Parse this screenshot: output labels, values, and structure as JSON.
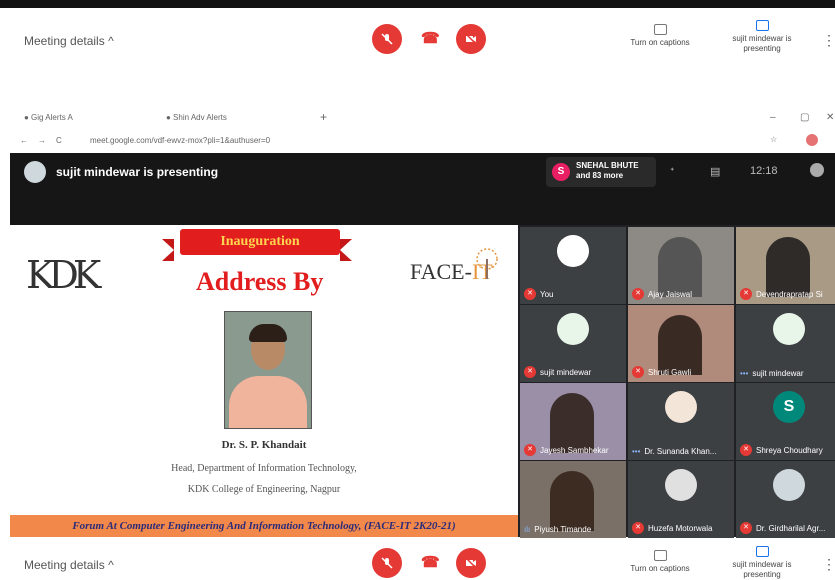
{
  "meeting": {
    "details_label": "Meeting details",
    "chevron": "^",
    "captions_label": "Turn on captions",
    "presenting_label": "sujit mindewar is presenting",
    "more_label": "⋮"
  },
  "browser": {
    "tab1": "● Gig Alerts A",
    "tab2": "● Shin Adv Alerts",
    "address": "meet.google.com/vdf-ewvz-mox?pli=1&authuser=0"
  },
  "present_bar": {
    "presenter": "sujit mindewar is presenting",
    "badge": "S",
    "participant_line1": "SNEHAL BHUTE",
    "participant_line2": "and 83 more",
    "clock": "12:18"
  },
  "slide": {
    "ribbon": "Inauguration",
    "heading": "Address By",
    "logo_left": "KDK",
    "logo_right_1": "FACE-",
    "logo_right_2": "IT",
    "person": "Dr. S. P. Khandait",
    "dept": "Head, Department of Information Technology,",
    "college": "KDK College of Engineering, Nagpur",
    "footer": "Forum At Computer Engineering And Information Technology, (FACE-IT 2K20-21)"
  },
  "participants": [
    {
      "name": "You"
    },
    {
      "name": "Ajay Jaiswal"
    },
    {
      "name": "Devendrapratap Si"
    },
    {
      "name": "sujit mindewar"
    },
    {
      "name": "Shruti Gawli"
    },
    {
      "name": "sujit mindewar"
    },
    {
      "name": "Jayesh Sambhekar"
    },
    {
      "name": "Dr. Sunanda Khan..."
    },
    {
      "name": "Shreya Choudhary",
      "initial": "S"
    },
    {
      "name": "Piyush Timande"
    },
    {
      "name": "Huzefa Motorwala"
    },
    {
      "name": "Dr. Girdharilal Agr..."
    }
  ],
  "colors": {
    "red": "#e53935",
    "dark": "#161616",
    "ribbon": "#e11d1d",
    "footer": "#f2894a",
    "footer_text": "#2b2b7a"
  }
}
